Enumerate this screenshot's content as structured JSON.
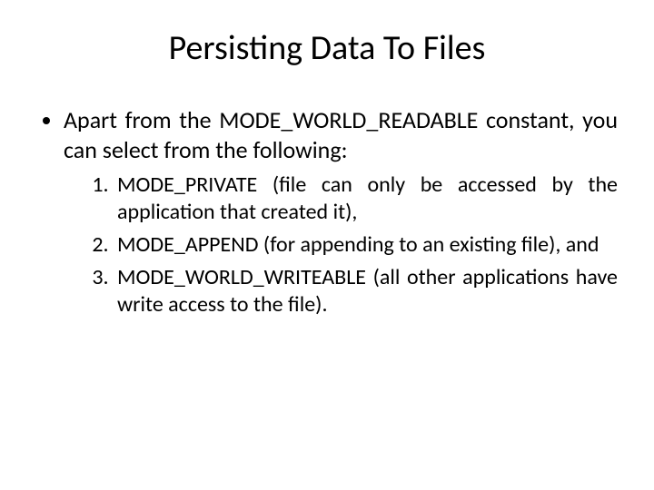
{
  "title": "Persisting Data To Files",
  "bullet_intro": "Apart from the MODE_WORLD_READABLE constant, you can select from the following:",
  "items": [
    "MODE_PRIVATE (file can only be accessed by the application that created it),",
    "MODE_APPEND (for appending to an existing file), and",
    "MODE_WORLD_WRITEABLE (all other applications have write access to the file)."
  ]
}
